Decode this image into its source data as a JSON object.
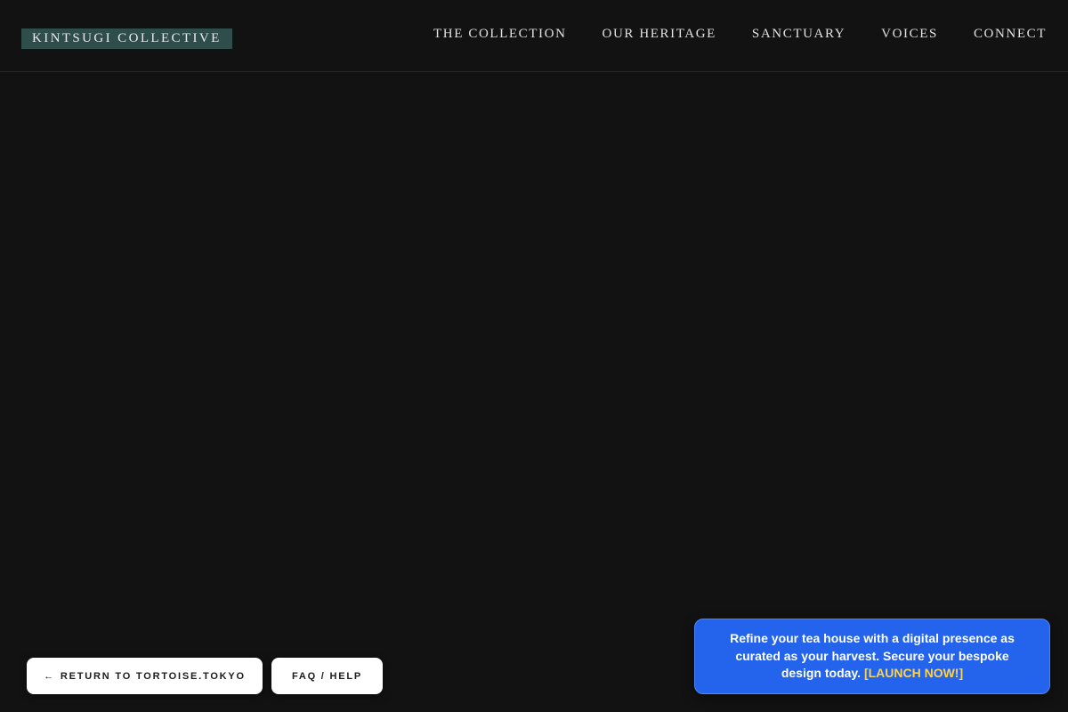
{
  "header": {
    "brand": "KINTSUGI COLLECTIVE",
    "nav": [
      {
        "label": "THE COLLECTION"
      },
      {
        "label": "OUR HERITAGE"
      },
      {
        "label": "SANCTUARY"
      },
      {
        "label": "VOICES"
      },
      {
        "label": "CONNECT"
      }
    ]
  },
  "footer_buttons": {
    "return_icon": "←",
    "return_label": "RETURN TO TORTOISE.TOKYO",
    "faq_label": "FAQ / HELP"
  },
  "promo": {
    "text": "Refine your tea house with a digital presence as curated as your harvest. Secure your bespoke design today. ",
    "cta": "[LAUNCH NOW!]"
  },
  "colors": {
    "background": "#121212",
    "brand_badge": "#2f4d4b",
    "promo_background": "#2463eb",
    "promo_cta": "#fcd34d",
    "button_background": "#ffffff"
  }
}
